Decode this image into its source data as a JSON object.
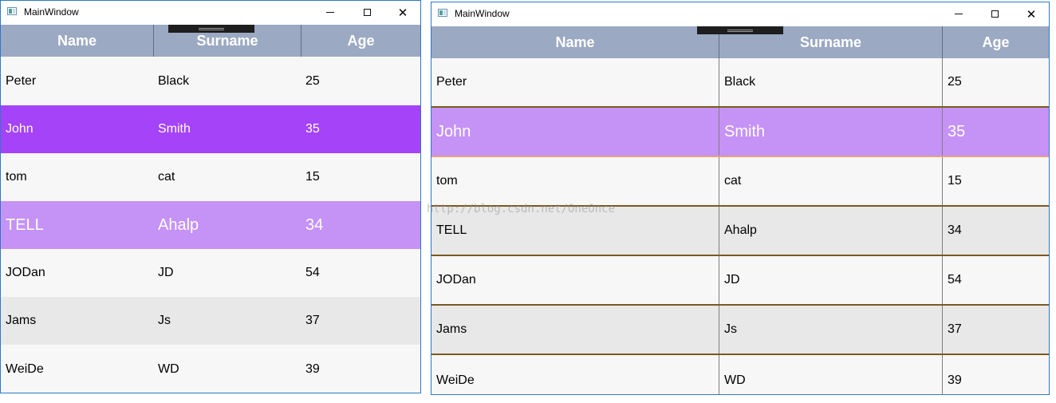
{
  "windows": [
    {
      "title": "MainWindow",
      "columns": [
        "Name",
        "Surname",
        "Age"
      ],
      "rows": [
        {
          "name": "Peter",
          "surname": "Black",
          "age": "25"
        },
        {
          "name": "John",
          "surname": "Smith",
          "age": "35"
        },
        {
          "name": "tom",
          "surname": "cat",
          "age": "15"
        },
        {
          "name": "TELL",
          "surname": "Ahalp",
          "age": "34"
        },
        {
          "name": "JODan",
          "surname": "JD",
          "age": "54"
        },
        {
          "name": "Jams",
          "surname": "Js",
          "age": "37"
        },
        {
          "name": "WeiDe",
          "surname": "WD",
          "age": "39"
        }
      ]
    },
    {
      "title": "MainWindow",
      "columns": [
        "Name",
        "Surname",
        "Age"
      ],
      "rows": [
        {
          "name": "Peter",
          "surname": "Black",
          "age": "25"
        },
        {
          "name": "John",
          "surname": "Smith",
          "age": "35"
        },
        {
          "name": "tom",
          "surname": "cat",
          "age": "15"
        },
        {
          "name": "TELL",
          "surname": "Ahalp",
          "age": "34"
        },
        {
          "name": "JODan",
          "surname": "JD",
          "age": "54"
        },
        {
          "name": "Jams",
          "surname": "Js",
          "age": "37"
        },
        {
          "name": "WeiDe",
          "surname": "WD",
          "age": "39"
        }
      ]
    }
  ],
  "watermark": "http://blog.csdn.net/OneOnce",
  "colors": {
    "header_bg": "#9ba9c2",
    "row_default": "#f7f7f7",
    "row_alt": "#e8e8e8",
    "selected": "#a443f8",
    "hover": "#c592f6",
    "window_border": "#2b79c8"
  }
}
